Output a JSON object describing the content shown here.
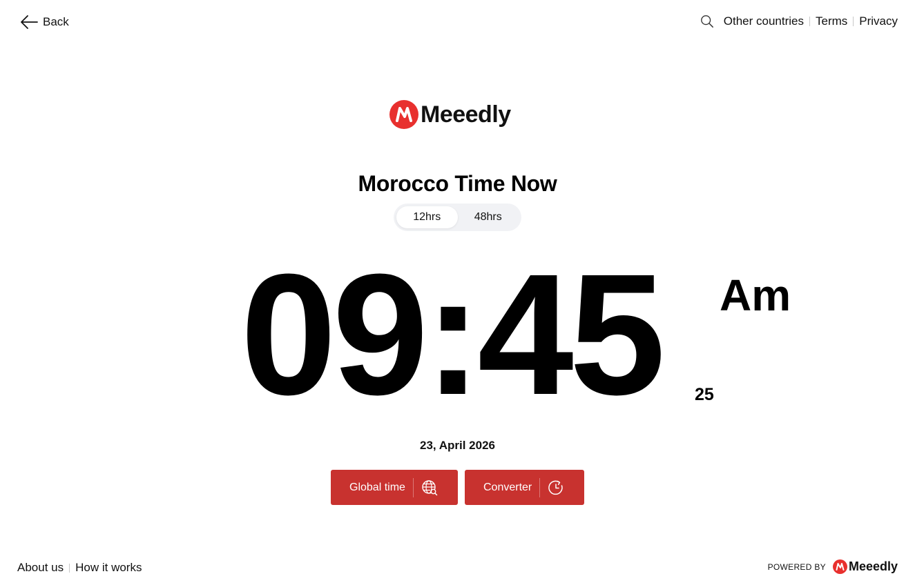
{
  "header": {
    "back_label": "Back",
    "nav": [
      "Other countries",
      "Terms",
      "Privacy"
    ]
  },
  "brand": {
    "name": "Meeedly",
    "color": "#e8302e"
  },
  "main": {
    "title": "Morocco Time Now",
    "toggle": {
      "options": [
        "12hrs",
        "48hrs"
      ],
      "active": "12hrs"
    },
    "time": "09:45",
    "seconds": "25",
    "period": "Am",
    "date": "23, April 2026"
  },
  "buttons": {
    "global_time": "Global time",
    "converter": "Converter",
    "color": "#c8322f"
  },
  "footer": {
    "links": [
      "About us",
      "How it works"
    ],
    "powered_by": "POWERED BY"
  }
}
